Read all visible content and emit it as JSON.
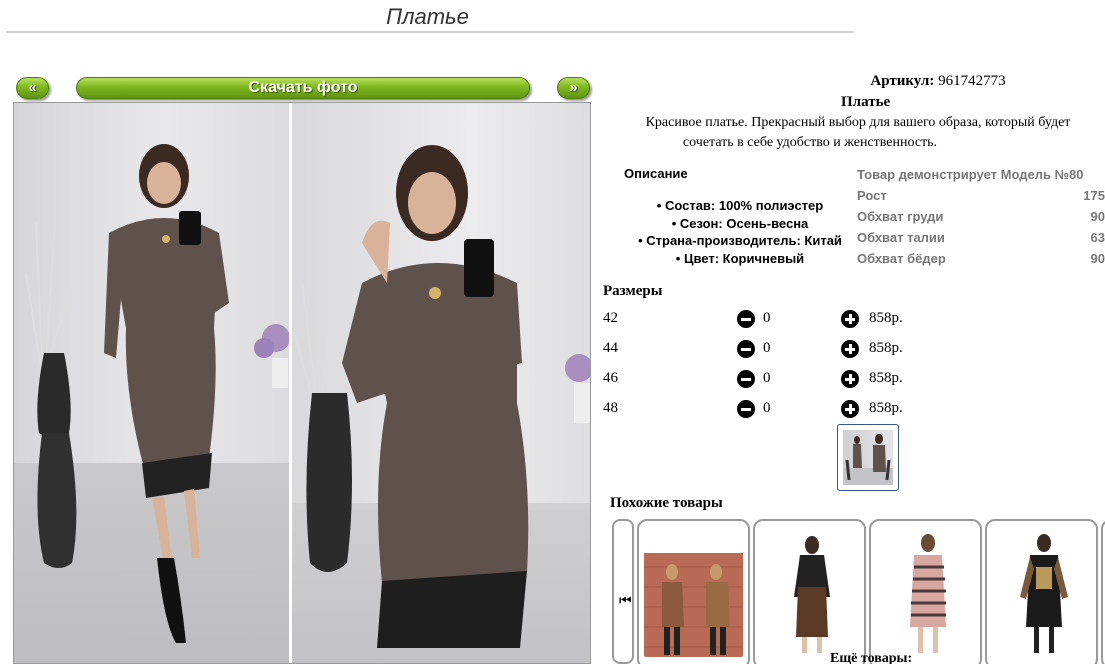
{
  "page_title": "Платье",
  "gallery": {
    "prev_label": "«",
    "download_label": "Скачать фото",
    "next_label": "»"
  },
  "product": {
    "article_label": "Артикул:",
    "article_value": "961742773",
    "name": "Платье",
    "description_line1": "Красивое платье. Прекрасный выбор для вашего образа, который будет",
    "description_line2": "сочетать в себе удобство и женственность."
  },
  "description": {
    "heading": "Описание",
    "features": [
      "Состав: 100% полиэстер",
      "Сезон: Осень-весна",
      "Страна-производитель: Китай",
      "Цвет: Коричневый"
    ]
  },
  "model": {
    "heading": "Товар демонстрирует Модель №80",
    "params": [
      {
        "label": "Рост",
        "value": "175"
      },
      {
        "label": "Обхват груди",
        "value": "90"
      },
      {
        "label": "Обхват талии",
        "value": "63"
      },
      {
        "label": "Обхват бёдер",
        "value": "90"
      }
    ]
  },
  "sizes": {
    "heading": "Размеры",
    "rows": [
      {
        "size": "42",
        "qty": "0",
        "price": "858р."
      },
      {
        "size": "44",
        "qty": "0",
        "price": "858р."
      },
      {
        "size": "46",
        "qty": "0",
        "price": "858р."
      },
      {
        "size": "48",
        "qty": "0",
        "price": "858р."
      }
    ]
  },
  "similar": {
    "heading": "Похожие товары",
    "left_arrow_icon": "skip-back-icon",
    "left_arrow_glyph": "⏮",
    "more_label": "Ещё товары:"
  },
  "colors": {
    "button_green": "#7fb820",
    "dress_brown": "#5f524d",
    "thumb_border": "#355a8a"
  }
}
